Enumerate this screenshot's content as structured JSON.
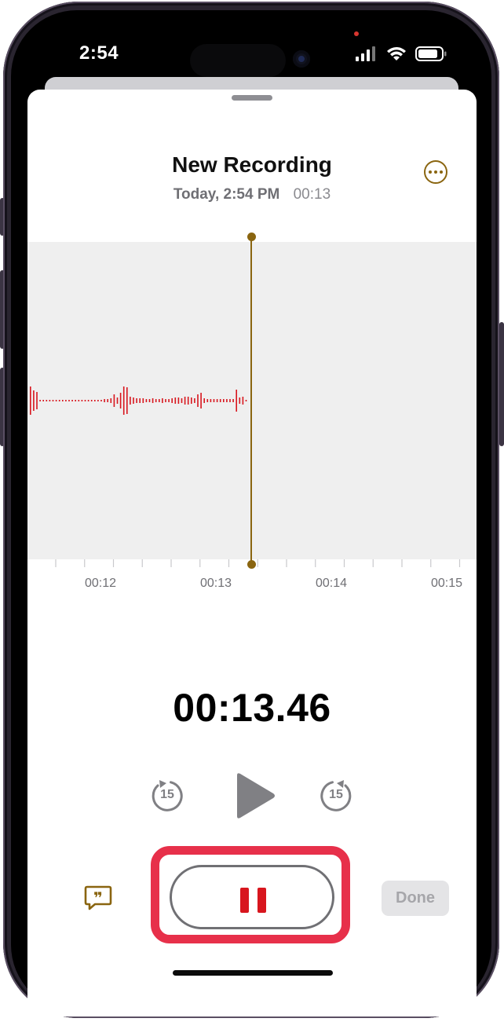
{
  "status_bar": {
    "time": "2:54"
  },
  "recording": {
    "title": "New Recording",
    "date": "Today, 2:54 PM",
    "duration": "00:13",
    "elapsed": "00:13.46"
  },
  "timeline": {
    "labels": [
      "00:12",
      "00:13",
      "00:14",
      "00:15"
    ]
  },
  "controls": {
    "skip_back": "15",
    "skip_forward": "15",
    "done_label": "Done"
  },
  "colors": {
    "accent": "#8a6510",
    "waveform": "#d8161e",
    "highlight": "#e7304a",
    "done_disabled_bg": "#e4e4e6"
  },
  "icons": {
    "more": "ellipsis-circle-icon",
    "transcript": "quote-bubble-icon",
    "play": "play-triangle-icon",
    "pause": "pause-icon",
    "skip_back": "gobackward-15-icon",
    "skip_forward": "goforward-15-icon"
  }
}
